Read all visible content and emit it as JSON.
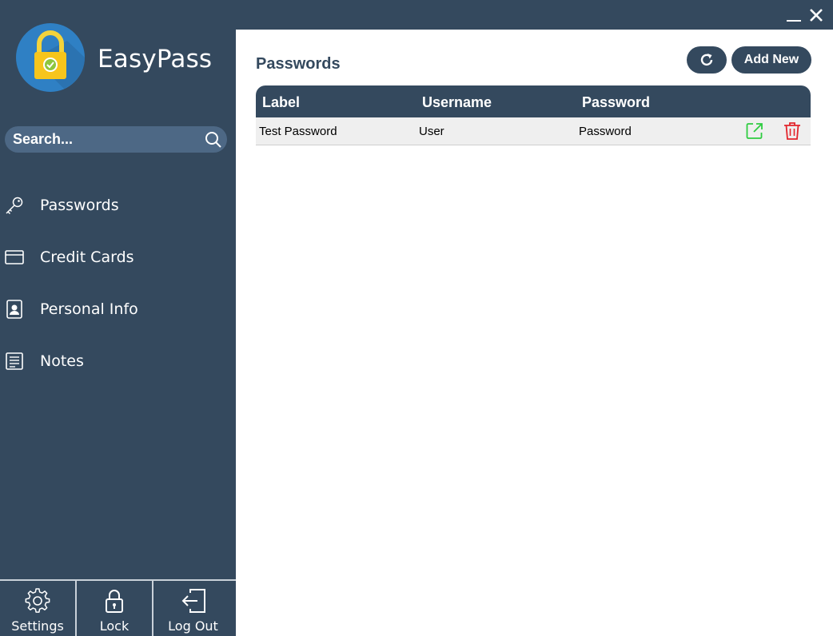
{
  "app": {
    "name": "EasyPass",
    "logo_icon": "padlock-check-icon",
    "colors": {
      "primary": "#34495e",
      "search_bg": "#4d6885",
      "content_bg": "#ffffff",
      "row_bg": "#efefef",
      "open_icon": "#2ecc40",
      "delete_icon": "#e3242b",
      "lock_yellow": "#f7c51c"
    }
  },
  "window_controls": {
    "minimize_icon": "minimize-icon",
    "close_icon": "close-icon"
  },
  "search": {
    "placeholder": "Search...",
    "value": "",
    "icon": "search-icon"
  },
  "nav": {
    "items": [
      {
        "label": "Passwords",
        "icon": "key-icon"
      },
      {
        "label": "Credit Cards",
        "icon": "credit-card-icon"
      },
      {
        "label": "Personal Info",
        "icon": "contact-card-icon"
      },
      {
        "label": "Notes",
        "icon": "notes-icon"
      }
    ]
  },
  "bottom": {
    "settings_label": "Settings",
    "lock_label": "Lock",
    "logout_label": "Log Out"
  },
  "main": {
    "title": "Passwords",
    "refresh_icon": "refresh-icon",
    "add_label": "Add New",
    "table": {
      "columns": [
        "Label",
        "Username",
        "Password"
      ],
      "rows": [
        {
          "label": "Test Password",
          "username": "User",
          "password": "Password"
        }
      ]
    }
  }
}
